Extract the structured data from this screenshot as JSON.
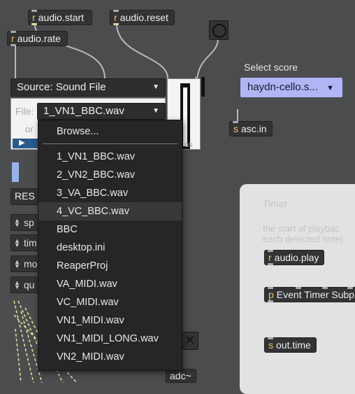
{
  "objects": {
    "audio_start": {
      "prefix": "r",
      "text": "audio.start"
    },
    "audio_reset": {
      "prefix": "r",
      "text": "audio.reset"
    },
    "audio_rate": {
      "prefix": "r",
      "text": "audio.rate"
    },
    "asc_in": {
      "prefix": "s",
      "text": "asc.in"
    },
    "audio_play": {
      "prefix": "r",
      "text": "audio.play"
    },
    "event_timer": {
      "prefix": "p",
      "text": "Event Timer Subp"
    },
    "out_time": {
      "prefix": "s",
      "text": "out.time"
    },
    "adc": {
      "text": "adc~"
    }
  },
  "source_menu": {
    "label": "Source: Sound File"
  },
  "file_menu": {
    "label": "File:",
    "selected": "1_VN1_BBC.wav"
  },
  "reset_button": {
    "label": "RES"
  },
  "select_score": {
    "label": "Select score",
    "selected": "haydn-cello.s..."
  },
  "timer_panel": {
    "title": "Timer",
    "line1": "the start of playbac",
    "line2": "each detected note)"
  },
  "param_boxes": [
    "sp",
    "tim",
    "mo",
    "qu"
  ],
  "dropdown": {
    "browse": "Browse...",
    "items": [
      "1_VN1_BBC.wav",
      "2_VN2_BBC.wav",
      "3_VA_BBC.wav",
      "4_VC_BBC.wav",
      "BBC",
      "desktop.ini",
      "ReaperProj",
      "VA_MIDI.wav",
      "VC_MIDI.wav",
      "VN1_MIDI.wav",
      "VN1_MIDI_LONG.wav",
      "VN2_MIDI.wav"
    ],
    "highlighted_index": 3
  },
  "colors": {
    "canvas": "#4b4c4e",
    "object_bg": "#333335",
    "score_menu": "#b0b6f5",
    "prefix": "#f0c060",
    "dropdown_bg": "#262628",
    "cable_signal": "#d9e39a"
  }
}
